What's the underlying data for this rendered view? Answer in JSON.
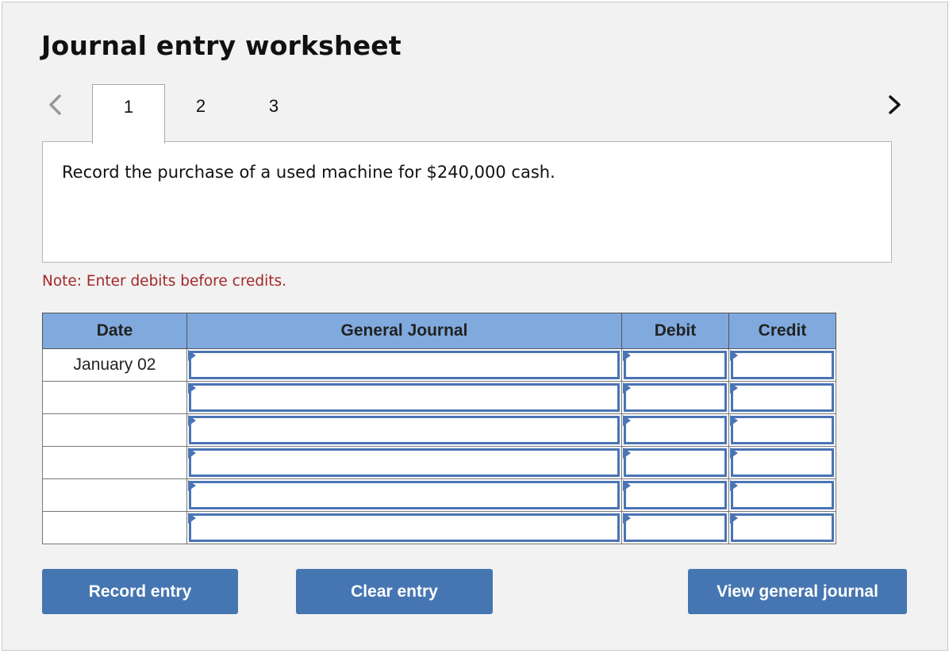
{
  "header": {
    "title": "Journal entry worksheet"
  },
  "navigation": {
    "prev_icon": "chevron-left-icon",
    "next_icon": "chevron-right-icon",
    "tabs": [
      {
        "label": "1",
        "active": true
      },
      {
        "label": "2",
        "active": false
      },
      {
        "label": "3",
        "active": false
      }
    ]
  },
  "question": {
    "text": "Record the purchase of a used machine for $240,000 cash."
  },
  "note": "Note: Enter debits before credits.",
  "journal": {
    "columns": [
      "Date",
      "General Journal",
      "Debit",
      "Credit"
    ],
    "rows": [
      {
        "date": "January 02",
        "account": "",
        "debit": "",
        "credit": ""
      },
      {
        "date": "",
        "account": "",
        "debit": "",
        "credit": ""
      },
      {
        "date": "",
        "account": "",
        "debit": "",
        "credit": ""
      },
      {
        "date": "",
        "account": "",
        "debit": "",
        "credit": ""
      },
      {
        "date": "",
        "account": "",
        "debit": "",
        "credit": ""
      },
      {
        "date": "",
        "account": "",
        "debit": "",
        "credit": ""
      }
    ]
  },
  "buttons": {
    "record": "Record entry",
    "clear": "Clear entry",
    "view": "View general journal"
  },
  "colors": {
    "header_bg": "#80aade",
    "button_bg": "#4676b2",
    "input_border": "#4a74b3",
    "note_text": "#a4272a"
  }
}
